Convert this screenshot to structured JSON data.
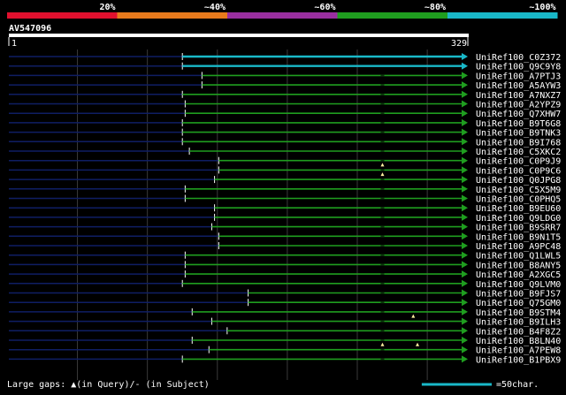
{
  "scale": {
    "labels": [
      "20%",
      "~40%",
      "~60%",
      "~80%",
      "~100%"
    ],
    "colors": [
      "#e0102e",
      "#e87a1c",
      "#9a2fa0",
      "#1f9e1f",
      "#19b8c8"
    ]
  },
  "query": {
    "name": "AV547096",
    "start": "1",
    "end": "329",
    "length": 329
  },
  "hits": [
    {
      "name": "UniRef100_C0Z372",
      "qs": 125,
      "qe": 329,
      "color": "#19b8c8",
      "marks": []
    },
    {
      "name": "UniRef100_Q9C9Y8",
      "qs": 125,
      "qe": 329,
      "color": "#19b8c8",
      "marks": []
    },
    {
      "name": "UniRef100_A7PTJ3",
      "qs": 139,
      "qe": 329,
      "color": "#1f9e1f",
      "marks": []
    },
    {
      "name": "UniRef100_A5AYW3",
      "qs": 139,
      "qe": 329,
      "color": "#1f9e1f",
      "marks": []
    },
    {
      "name": "UniRef100_A7NXZ7",
      "qs": 125,
      "qe": 329,
      "color": "#1f9e1f",
      "marks": []
    },
    {
      "name": "UniRef100_A2YPZ9",
      "qs": 127,
      "qe": 329,
      "color": "#1f9e1f",
      "marks": []
    },
    {
      "name": "UniRef100_Q7XHW7",
      "qs": 127,
      "qe": 329,
      "color": "#1f9e1f",
      "marks": []
    },
    {
      "name": "UniRef100_B9T6G8",
      "qs": 125,
      "qe": 329,
      "color": "#1f9e1f",
      "marks": []
    },
    {
      "name": "UniRef100_B9TNK3",
      "qs": 125,
      "qe": 329,
      "color": "#1f9e1f",
      "marks": []
    },
    {
      "name": "UniRef100_B9I768",
      "qs": 125,
      "qe": 329,
      "color": "#1f9e1f",
      "marks": []
    },
    {
      "name": "UniRef100_C5XKC2",
      "qs": 130,
      "qe": 329,
      "color": "#1f9e1f",
      "marks": []
    },
    {
      "name": "UniRef100_C0P9J9",
      "qs": 151,
      "qe": 329,
      "color": "#1f9e1f",
      "marks": []
    },
    {
      "name": "UniRef100_C0P9C6",
      "qs": 151,
      "qe": 329,
      "color": "#1f9e1f",
      "marks": [
        268
      ]
    },
    {
      "name": "UniRef100_Q0JPG8",
      "qs": 148,
      "qe": 329,
      "color": "#1f9e1f",
      "marks": [
        268
      ]
    },
    {
      "name": "UniRef100_C5X5M9",
      "qs": 127,
      "qe": 329,
      "color": "#1f9e1f",
      "marks": []
    },
    {
      "name": "UniRef100_C0PHQ5",
      "qs": 127,
      "qe": 329,
      "color": "#1f9e1f",
      "marks": []
    },
    {
      "name": "UniRef100_B9EU60",
      "qs": 148,
      "qe": 329,
      "color": "#1f9e1f",
      "marks": []
    },
    {
      "name": "UniRef100_Q9LDG0",
      "qs": 148,
      "qe": 329,
      "color": "#1f9e1f",
      "marks": []
    },
    {
      "name": "UniRef100_B9SRR7",
      "qs": 146,
      "qe": 329,
      "color": "#1f9e1f",
      "marks": []
    },
    {
      "name": "UniRef100_B9N1T5",
      "qs": 151,
      "qe": 329,
      "color": "#1f9e1f",
      "marks": []
    },
    {
      "name": "UniRef100_A9PC48",
      "qs": 151,
      "qe": 329,
      "color": "#1f9e1f",
      "marks": []
    },
    {
      "name": "UniRef100_Q1LWL5",
      "qs": 127,
      "qe": 329,
      "color": "#1f9e1f",
      "marks": []
    },
    {
      "name": "UniRef100_B8ANY5",
      "qs": 127,
      "qe": 329,
      "color": "#1f9e1f",
      "marks": []
    },
    {
      "name": "UniRef100_A2XGC5",
      "qs": 127,
      "qe": 329,
      "color": "#1f9e1f",
      "marks": []
    },
    {
      "name": "UniRef100_Q9LVM0",
      "qs": 125,
      "qe": 329,
      "color": "#1f9e1f",
      "marks": []
    },
    {
      "name": "UniRef100_B9FJS7",
      "qs": 172,
      "qe": 329,
      "color": "#1f9e1f",
      "marks": []
    },
    {
      "name": "UniRef100_Q75GM0",
      "qs": 172,
      "qe": 329,
      "color": "#1f9e1f",
      "marks": []
    },
    {
      "name": "UniRef100_B9STM4",
      "qs": 132,
      "qe": 329,
      "color": "#1f9e1f",
      "marks": []
    },
    {
      "name": "UniRef100_B9ILH3",
      "qs": 146,
      "qe": 329,
      "color": "#1f9e1f",
      "marks": [
        290
      ]
    },
    {
      "name": "UniRef100_B4F8Z2",
      "qs": 157,
      "qe": 329,
      "color": "#1f9e1f",
      "marks": []
    },
    {
      "name": "UniRef100_B8LN40",
      "qs": 132,
      "qe": 329,
      "color": "#1f9e1f",
      "marks": []
    },
    {
      "name": "UniRef100_A7PEW8",
      "qs": 144,
      "qe": 329,
      "color": "#1f9e1f",
      "marks": [
        268,
        293
      ]
    },
    {
      "name": "UniRef100_B1PBX9",
      "qs": 125,
      "qe": 329,
      "color": "#1f9e1f",
      "marks": []
    }
  ],
  "legend": {
    "gaps_text": "Large gaps: ▲(in Query)/- (in Subject)",
    "scale_text": "=50char.",
    "scale_color": "#19b8c8",
    "scale_chars": 50
  }
}
